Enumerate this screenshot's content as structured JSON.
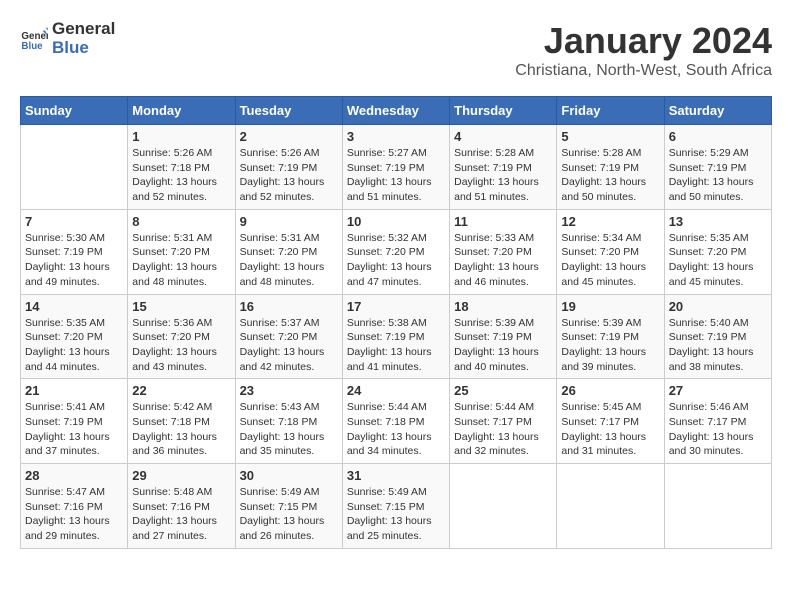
{
  "header": {
    "logo_general": "General",
    "logo_blue": "Blue",
    "month": "January 2024",
    "location": "Christiana, North-West, South Africa"
  },
  "days_of_week": [
    "Sunday",
    "Monday",
    "Tuesday",
    "Wednesday",
    "Thursday",
    "Friday",
    "Saturday"
  ],
  "weeks": [
    [
      {
        "day": "",
        "content": ""
      },
      {
        "day": "1",
        "content": "Sunrise: 5:26 AM\nSunset: 7:18 PM\nDaylight: 13 hours\nand 52 minutes."
      },
      {
        "day": "2",
        "content": "Sunrise: 5:26 AM\nSunset: 7:19 PM\nDaylight: 13 hours\nand 52 minutes."
      },
      {
        "day": "3",
        "content": "Sunrise: 5:27 AM\nSunset: 7:19 PM\nDaylight: 13 hours\nand 51 minutes."
      },
      {
        "day": "4",
        "content": "Sunrise: 5:28 AM\nSunset: 7:19 PM\nDaylight: 13 hours\nand 51 minutes."
      },
      {
        "day": "5",
        "content": "Sunrise: 5:28 AM\nSunset: 7:19 PM\nDaylight: 13 hours\nand 50 minutes."
      },
      {
        "day": "6",
        "content": "Sunrise: 5:29 AM\nSunset: 7:19 PM\nDaylight: 13 hours\nand 50 minutes."
      }
    ],
    [
      {
        "day": "7",
        "content": "Sunrise: 5:30 AM\nSunset: 7:19 PM\nDaylight: 13 hours\nand 49 minutes."
      },
      {
        "day": "8",
        "content": "Sunrise: 5:31 AM\nSunset: 7:20 PM\nDaylight: 13 hours\nand 48 minutes."
      },
      {
        "day": "9",
        "content": "Sunrise: 5:31 AM\nSunset: 7:20 PM\nDaylight: 13 hours\nand 48 minutes."
      },
      {
        "day": "10",
        "content": "Sunrise: 5:32 AM\nSunset: 7:20 PM\nDaylight: 13 hours\nand 47 minutes."
      },
      {
        "day": "11",
        "content": "Sunrise: 5:33 AM\nSunset: 7:20 PM\nDaylight: 13 hours\nand 46 minutes."
      },
      {
        "day": "12",
        "content": "Sunrise: 5:34 AM\nSunset: 7:20 PM\nDaylight: 13 hours\nand 45 minutes."
      },
      {
        "day": "13",
        "content": "Sunrise: 5:35 AM\nSunset: 7:20 PM\nDaylight: 13 hours\nand 45 minutes."
      }
    ],
    [
      {
        "day": "14",
        "content": "Sunrise: 5:35 AM\nSunset: 7:20 PM\nDaylight: 13 hours\nand 44 minutes."
      },
      {
        "day": "15",
        "content": "Sunrise: 5:36 AM\nSunset: 7:20 PM\nDaylight: 13 hours\nand 43 minutes."
      },
      {
        "day": "16",
        "content": "Sunrise: 5:37 AM\nSunset: 7:20 PM\nDaylight: 13 hours\nand 42 minutes."
      },
      {
        "day": "17",
        "content": "Sunrise: 5:38 AM\nSunset: 7:19 PM\nDaylight: 13 hours\nand 41 minutes."
      },
      {
        "day": "18",
        "content": "Sunrise: 5:39 AM\nSunset: 7:19 PM\nDaylight: 13 hours\nand 40 minutes."
      },
      {
        "day": "19",
        "content": "Sunrise: 5:39 AM\nSunset: 7:19 PM\nDaylight: 13 hours\nand 39 minutes."
      },
      {
        "day": "20",
        "content": "Sunrise: 5:40 AM\nSunset: 7:19 PM\nDaylight: 13 hours\nand 38 minutes."
      }
    ],
    [
      {
        "day": "21",
        "content": "Sunrise: 5:41 AM\nSunset: 7:19 PM\nDaylight: 13 hours\nand 37 minutes."
      },
      {
        "day": "22",
        "content": "Sunrise: 5:42 AM\nSunset: 7:18 PM\nDaylight: 13 hours\nand 36 minutes."
      },
      {
        "day": "23",
        "content": "Sunrise: 5:43 AM\nSunset: 7:18 PM\nDaylight: 13 hours\nand 35 minutes."
      },
      {
        "day": "24",
        "content": "Sunrise: 5:44 AM\nSunset: 7:18 PM\nDaylight: 13 hours\nand 34 minutes."
      },
      {
        "day": "25",
        "content": "Sunrise: 5:44 AM\nSunset: 7:17 PM\nDaylight: 13 hours\nand 32 minutes."
      },
      {
        "day": "26",
        "content": "Sunrise: 5:45 AM\nSunset: 7:17 PM\nDaylight: 13 hours\nand 31 minutes."
      },
      {
        "day": "27",
        "content": "Sunrise: 5:46 AM\nSunset: 7:17 PM\nDaylight: 13 hours\nand 30 minutes."
      }
    ],
    [
      {
        "day": "28",
        "content": "Sunrise: 5:47 AM\nSunset: 7:16 PM\nDaylight: 13 hours\nand 29 minutes."
      },
      {
        "day": "29",
        "content": "Sunrise: 5:48 AM\nSunset: 7:16 PM\nDaylight: 13 hours\nand 27 minutes."
      },
      {
        "day": "30",
        "content": "Sunrise: 5:49 AM\nSunset: 7:15 PM\nDaylight: 13 hours\nand 26 minutes."
      },
      {
        "day": "31",
        "content": "Sunrise: 5:49 AM\nSunset: 7:15 PM\nDaylight: 13 hours\nand 25 minutes."
      },
      {
        "day": "",
        "content": ""
      },
      {
        "day": "",
        "content": ""
      },
      {
        "day": "",
        "content": ""
      }
    ]
  ]
}
